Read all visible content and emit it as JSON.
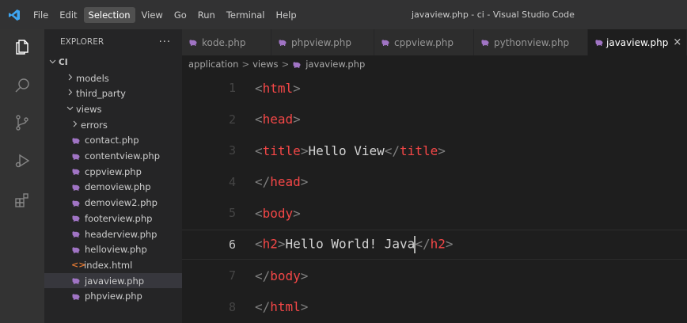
{
  "window": {
    "title": "javaview.php - ci - Visual Studio Code"
  },
  "menu": [
    "File",
    "Edit",
    "Selection",
    "View",
    "Go",
    "Run",
    "Terminal",
    "Help"
  ],
  "menu_active": "Selection",
  "activity": [
    "files-icon",
    "search-icon",
    "source-control-icon",
    "run-debug-icon",
    "extensions-icon"
  ],
  "sidebar": {
    "title": "EXPLORER",
    "dots": "···",
    "root": "CI",
    "items": [
      {
        "label": "models",
        "kind": "folder-closed",
        "depth": 1
      },
      {
        "label": "third_party",
        "kind": "folder-closed",
        "depth": 1
      },
      {
        "label": "views",
        "kind": "folder-open",
        "depth": 1
      },
      {
        "label": "errors",
        "kind": "folder-closed",
        "depth": 2
      },
      {
        "label": "contact.php",
        "kind": "php",
        "depth": 2
      },
      {
        "label": "contentview.php",
        "kind": "php",
        "depth": 2
      },
      {
        "label": "cppview.php",
        "kind": "php",
        "depth": 2
      },
      {
        "label": "demoview.php",
        "kind": "php",
        "depth": 2
      },
      {
        "label": "demoview2.php",
        "kind": "php",
        "depth": 2
      },
      {
        "label": "footerview.php",
        "kind": "php",
        "depth": 2
      },
      {
        "label": "headerview.php",
        "kind": "php",
        "depth": 2
      },
      {
        "label": "helloview.php",
        "kind": "php",
        "depth": 2
      },
      {
        "label": "index.html",
        "kind": "html",
        "depth": 2
      },
      {
        "label": "javaview.php",
        "kind": "php",
        "depth": 2,
        "selected": true
      },
      {
        "label": "phpview.php",
        "kind": "php",
        "depth": 2
      }
    ]
  },
  "tabs": [
    {
      "label": "kode.php",
      "active": false
    },
    {
      "label": "phpview.php",
      "active": false
    },
    {
      "label": "cppview.php",
      "active": false
    },
    {
      "label": "pythonview.php",
      "active": false
    },
    {
      "label": "javaview.php",
      "active": true
    }
  ],
  "tab_close": "×",
  "breadcrumb": [
    "application",
    "views",
    "javaview.php"
  ],
  "breadcrumb_sep": ">",
  "editor": {
    "current_line": 6,
    "lines": [
      {
        "n": "1",
        "tokens": [
          [
            "p",
            "<"
          ],
          [
            "t",
            "html"
          ],
          [
            "p",
            ">"
          ]
        ]
      },
      {
        "n": "2",
        "tokens": [
          [
            "p",
            "<"
          ],
          [
            "t",
            "head"
          ],
          [
            "p",
            ">"
          ]
        ]
      },
      {
        "n": "3",
        "tokens": [
          [
            "p",
            "<"
          ],
          [
            "t",
            "title"
          ],
          [
            "p",
            ">"
          ],
          [
            "x",
            "Hello View"
          ],
          [
            "p",
            "</"
          ],
          [
            "t",
            "title"
          ],
          [
            "p",
            ">"
          ]
        ]
      },
      {
        "n": "4",
        "tokens": [
          [
            "p",
            "</"
          ],
          [
            "t",
            "head"
          ],
          [
            "p",
            ">"
          ]
        ]
      },
      {
        "n": "5",
        "tokens": [
          [
            "p",
            "<"
          ],
          [
            "t",
            "body"
          ],
          [
            "p",
            ">"
          ]
        ]
      },
      {
        "n": "6",
        "tokens": [
          [
            "p",
            "<"
          ],
          [
            "t",
            "h2"
          ],
          [
            "p",
            ">"
          ],
          [
            "x",
            "Hello World! Java"
          ],
          [
            "c",
            ""
          ],
          [
            "p",
            "</"
          ],
          [
            "t",
            "h2"
          ],
          [
            "p",
            ">"
          ]
        ]
      },
      {
        "n": "7",
        "tokens": [
          [
            "p",
            "</"
          ],
          [
            "t",
            "body"
          ],
          [
            "p",
            ">"
          ]
        ]
      },
      {
        "n": "8",
        "tokens": [
          [
            "p",
            "</"
          ],
          [
            "t",
            "html"
          ],
          [
            "p",
            ">"
          ]
        ]
      }
    ]
  },
  "colors": {
    "tag": "#f44747",
    "punct": "#808080",
    "text": "#d4d4d4",
    "php_icon": "#a074c4",
    "accent": "#0078d4"
  }
}
